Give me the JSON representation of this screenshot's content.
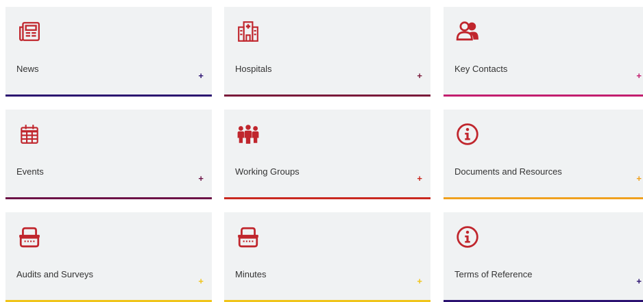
{
  "theme": {
    "icon_color": "#c0262d",
    "tile_background": "#f0f2f3",
    "label_color": "#333333"
  },
  "tiles": [
    {
      "label": "News",
      "plus": "+",
      "icon": "newspaper-icon",
      "accent": "#2b1270"
    },
    {
      "label": "Hospitals",
      "plus": "+",
      "icon": "hospital-icon",
      "accent": "#7a1a3a"
    },
    {
      "label": "Key Contacts",
      "plus": "+",
      "icon": "contacts-icon",
      "accent": "#c21e6e"
    },
    {
      "label": "Events",
      "plus": "+",
      "icon": "calendar-icon",
      "accent": "#6c1246"
    },
    {
      "label": "Working Groups",
      "plus": "+",
      "icon": "group-icon",
      "accent": "#c9281f"
    },
    {
      "label": "Documents and Resources",
      "plus": "+",
      "icon": "info-icon",
      "accent": "#f0a11e"
    },
    {
      "label": "Audits and Surveys",
      "plus": "+",
      "icon": "basket-icon",
      "accent": "#f0c419"
    },
    {
      "label": "Minutes",
      "plus": "+",
      "icon": "basket-icon",
      "accent": "#f0c419"
    },
    {
      "label": "Terms of Reference",
      "plus": "+",
      "icon": "info-icon",
      "accent": "#2b1270"
    }
  ]
}
